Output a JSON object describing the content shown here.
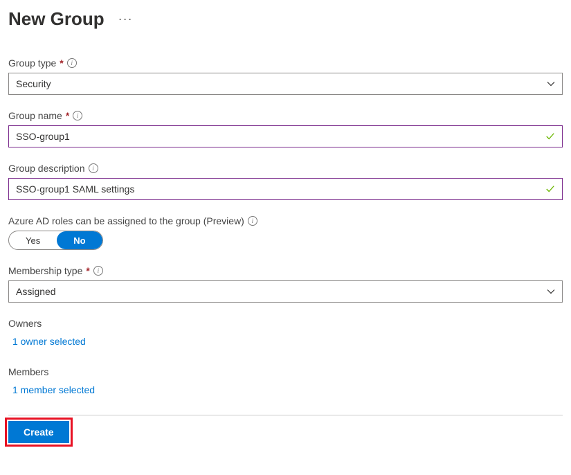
{
  "header": {
    "title": "New Group"
  },
  "fields": {
    "group_type": {
      "label": "Group type",
      "value": "Security",
      "required": true
    },
    "group_name": {
      "label": "Group name",
      "value": "SSO-group1",
      "required": true
    },
    "group_description": {
      "label": "Group description",
      "value": "SSO-group1 SAML settings",
      "required": false
    },
    "azure_roles": {
      "label": "Azure AD roles can be assigned to the group (Preview)",
      "option_yes": "Yes",
      "option_no": "No",
      "selected": "No"
    },
    "membership_type": {
      "label": "Membership type",
      "value": "Assigned",
      "required": true
    }
  },
  "sections": {
    "owners": {
      "label": "Owners",
      "link_text": "1 owner selected"
    },
    "members": {
      "label": "Members",
      "link_text": "1 member selected"
    }
  },
  "footer": {
    "create_button": "Create"
  },
  "required_marker": "*"
}
